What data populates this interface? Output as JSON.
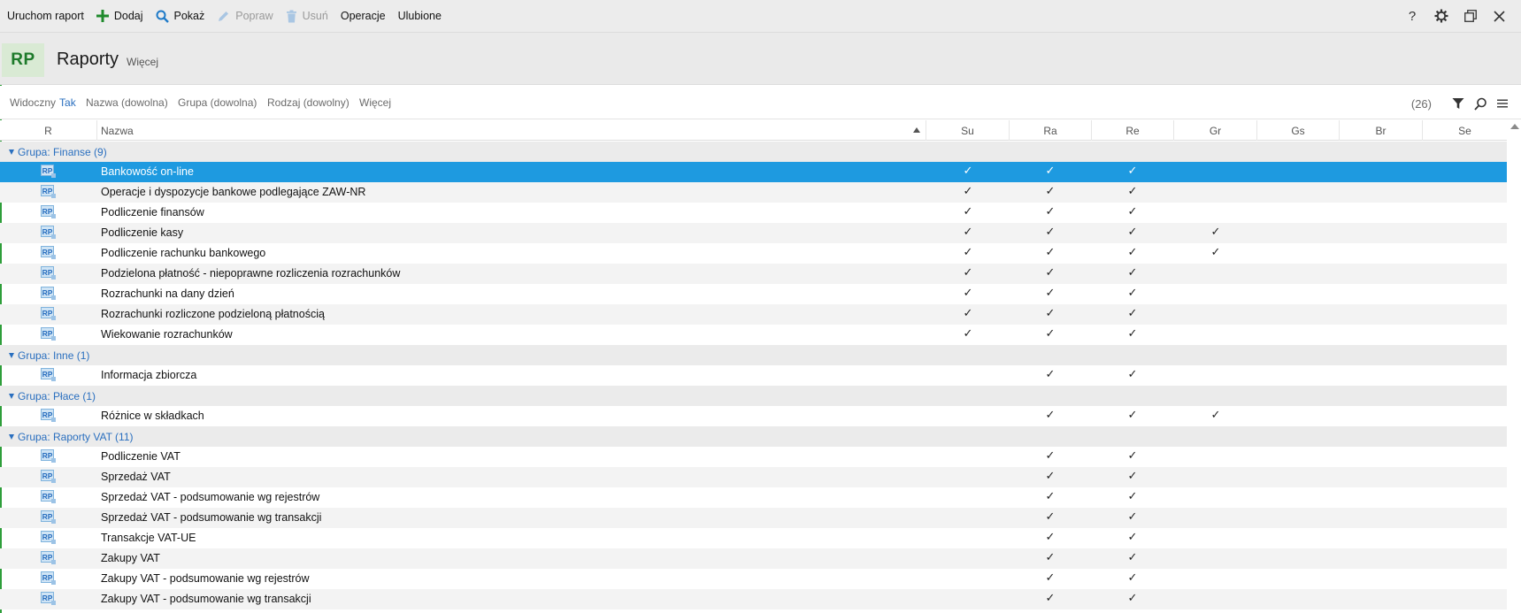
{
  "toolbar": {
    "run_report": "Uruchom raport",
    "add": "Dodaj",
    "show": "Pokaż",
    "edit": "Popraw",
    "delete": "Usuń",
    "operations": "Operacje",
    "favorites": "Ulubione"
  },
  "header": {
    "logo": "RP",
    "title": "Raporty",
    "more": "Więcej"
  },
  "filters": {
    "visible_label": "Widoczny",
    "visible_value": "Tak",
    "name": "Nazwa (dowolna)",
    "group": "Grupa (dowolna)",
    "kind": "Rodzaj (dowolny)",
    "more": "Więcej",
    "count": "(26)"
  },
  "columns": {
    "r": "R",
    "name": "Nazwa",
    "su": "Su",
    "ra": "Ra",
    "re": "Re",
    "gr": "Gr",
    "gs": "Gs",
    "br": "Br",
    "se": "Se"
  },
  "check_glyph": "✓",
  "colors": {
    "accent_green": "#2e9e3a",
    "selection_blue": "#1e9ae0",
    "group_text_blue": "#2a6fbf"
  },
  "rows": [
    {
      "type": "group",
      "label": "Grupa: Finanse (9)"
    },
    {
      "type": "item",
      "name": "Bankowość on-line",
      "su": true,
      "ra": true,
      "re": true,
      "gr": false,
      "selected": true
    },
    {
      "type": "item",
      "name": "Operacje i dyspozycje bankowe podlegające ZAW-NR",
      "su": true,
      "ra": true,
      "re": true,
      "gr": false
    },
    {
      "type": "item",
      "name": "Podliczenie finansów",
      "su": true,
      "ra": true,
      "re": true,
      "gr": false
    },
    {
      "type": "item",
      "name": "Podliczenie kasy",
      "su": true,
      "ra": true,
      "re": true,
      "gr": true
    },
    {
      "type": "item",
      "name": "Podliczenie rachunku bankowego",
      "su": true,
      "ra": true,
      "re": true,
      "gr": true
    },
    {
      "type": "item",
      "name": "Podzielona płatność - niepoprawne rozliczenia rozrachunków",
      "su": true,
      "ra": true,
      "re": true,
      "gr": false
    },
    {
      "type": "item",
      "name": "Rozrachunki na dany dzień",
      "su": true,
      "ra": true,
      "re": true,
      "gr": false
    },
    {
      "type": "item",
      "name": "Rozrachunki rozliczone podzieloną płatnością",
      "su": true,
      "ra": true,
      "re": true,
      "gr": false
    },
    {
      "type": "item",
      "name": "Wiekowanie rozrachunków",
      "su": true,
      "ra": true,
      "re": true,
      "gr": false
    },
    {
      "type": "group",
      "label": "Grupa: Inne (1)"
    },
    {
      "type": "item",
      "name": "Informacja zbiorcza",
      "su": false,
      "ra": true,
      "re": true,
      "gr": false
    },
    {
      "type": "group",
      "label": "Grupa: Płace (1)"
    },
    {
      "type": "item",
      "name": "Różnice w składkach",
      "su": false,
      "ra": true,
      "re": true,
      "gr": true
    },
    {
      "type": "group",
      "label": "Grupa: Raporty VAT (11)"
    },
    {
      "type": "item",
      "name": "Podliczenie VAT",
      "su": false,
      "ra": true,
      "re": true,
      "gr": false
    },
    {
      "type": "item",
      "name": "Sprzedaż VAT",
      "su": false,
      "ra": true,
      "re": true,
      "gr": false
    },
    {
      "type": "item",
      "name": "Sprzedaż VAT - podsumowanie wg rejestrów",
      "su": false,
      "ra": true,
      "re": true,
      "gr": false
    },
    {
      "type": "item",
      "name": "Sprzedaż VAT - podsumowanie wg transakcji",
      "su": false,
      "ra": true,
      "re": true,
      "gr": false
    },
    {
      "type": "item",
      "name": "Transakcje VAT-UE",
      "su": false,
      "ra": true,
      "re": true,
      "gr": false
    },
    {
      "type": "item",
      "name": "Zakupy VAT",
      "su": false,
      "ra": true,
      "re": true,
      "gr": false
    },
    {
      "type": "item",
      "name": "Zakupy VAT - podsumowanie wg rejestrów",
      "su": false,
      "ra": true,
      "re": true,
      "gr": false
    },
    {
      "type": "item",
      "name": "Zakupy VAT - podsumowanie wg transakcji",
      "su": false,
      "ra": true,
      "re": true,
      "gr": false
    }
  ]
}
